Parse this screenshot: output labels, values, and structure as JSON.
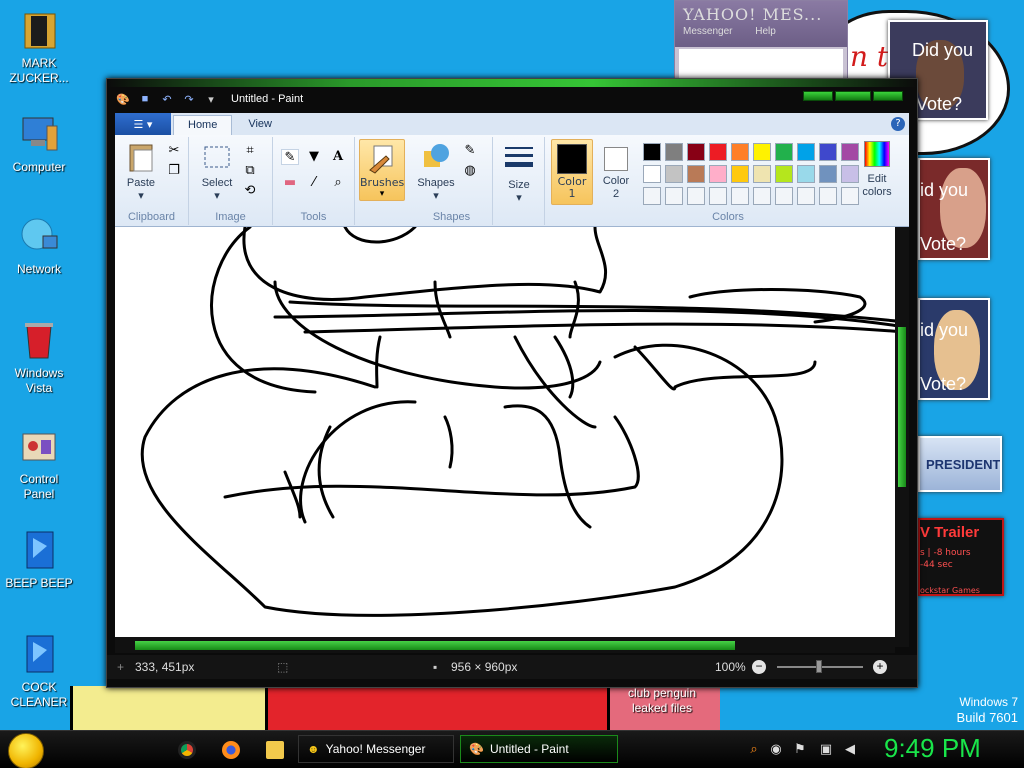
{
  "desktop": {
    "icons": [
      {
        "label": "MARK ZUCKER..."
      },
      {
        "label": "Computer"
      },
      {
        "label": "Network"
      },
      {
        "label": "Windows Vista"
      },
      {
        "label": "Control Panel"
      },
      {
        "label": "BEEP BEEP"
      },
      {
        "label": "COCK CLEANER"
      }
    ],
    "file_label": "club penguin leaked files",
    "promos": {
      "did_you_vote_1a": "Did you",
      "did_you_vote_1b": "Vote?",
      "did_you_vote_2a": "id you",
      "did_you_vote_2b": "Vote?",
      "did_you_vote_3a": "id you",
      "did_you_vote_3b": "Vote?",
      "president": "PRESIDENT",
      "trailer": "V Trailer",
      "trailer_sub1": "s | -8 hours",
      "trailer_sub2": "-44 sec",
      "trailer_sub3": "ockstar Games",
      "partial_red": "n t"
    },
    "windows_version": "Windows 7",
    "build": "Build 7601"
  },
  "messenger_window": {
    "logo": "YAHOO! MES...",
    "menu": [
      "Messenger",
      "Help"
    ]
  },
  "paint": {
    "title": "Untitled - Paint",
    "tabs": [
      "Home",
      "View"
    ],
    "groups": {
      "clipboard": {
        "label": "Clipboard",
        "paste": "Paste"
      },
      "image": {
        "label": "Image",
        "select": "Select"
      },
      "tools": {
        "label": "Tools"
      },
      "brushes": {
        "label": "Brushes"
      },
      "shapes": {
        "label": "Shapes",
        "shapes_btn": "Shapes"
      },
      "size": {
        "label": "Size"
      },
      "colors": {
        "label": "Colors",
        "color1": "Color 1",
        "color2": "Color 2",
        "edit": "Edit colors",
        "color1_value": "#000000",
        "color2_value": "#ffffff",
        "palette_row1": [
          "#000000",
          "#7f7f7f",
          "#880015",
          "#ed1c24",
          "#ff7f27",
          "#fff200",
          "#22b14c",
          "#00a2e8",
          "#3f48cc",
          "#a349a4"
        ],
        "palette_row2": [
          "#ffffff",
          "#c3c3c3",
          "#b97a57",
          "#ffaec9",
          "#ffc90e",
          "#efe4b0",
          "#b5e61d",
          "#99d9ea",
          "#7092be",
          "#c8bfe7"
        ]
      }
    },
    "status": {
      "cursor_pos": "333, 451px",
      "canvas_size": "956 × 960px",
      "zoom": "100%"
    }
  },
  "taskbar": {
    "tasks": [
      {
        "label": "Yahoo! Messenger"
      },
      {
        "label": "Untitled - Paint"
      }
    ],
    "clock": "9:49 PM"
  }
}
